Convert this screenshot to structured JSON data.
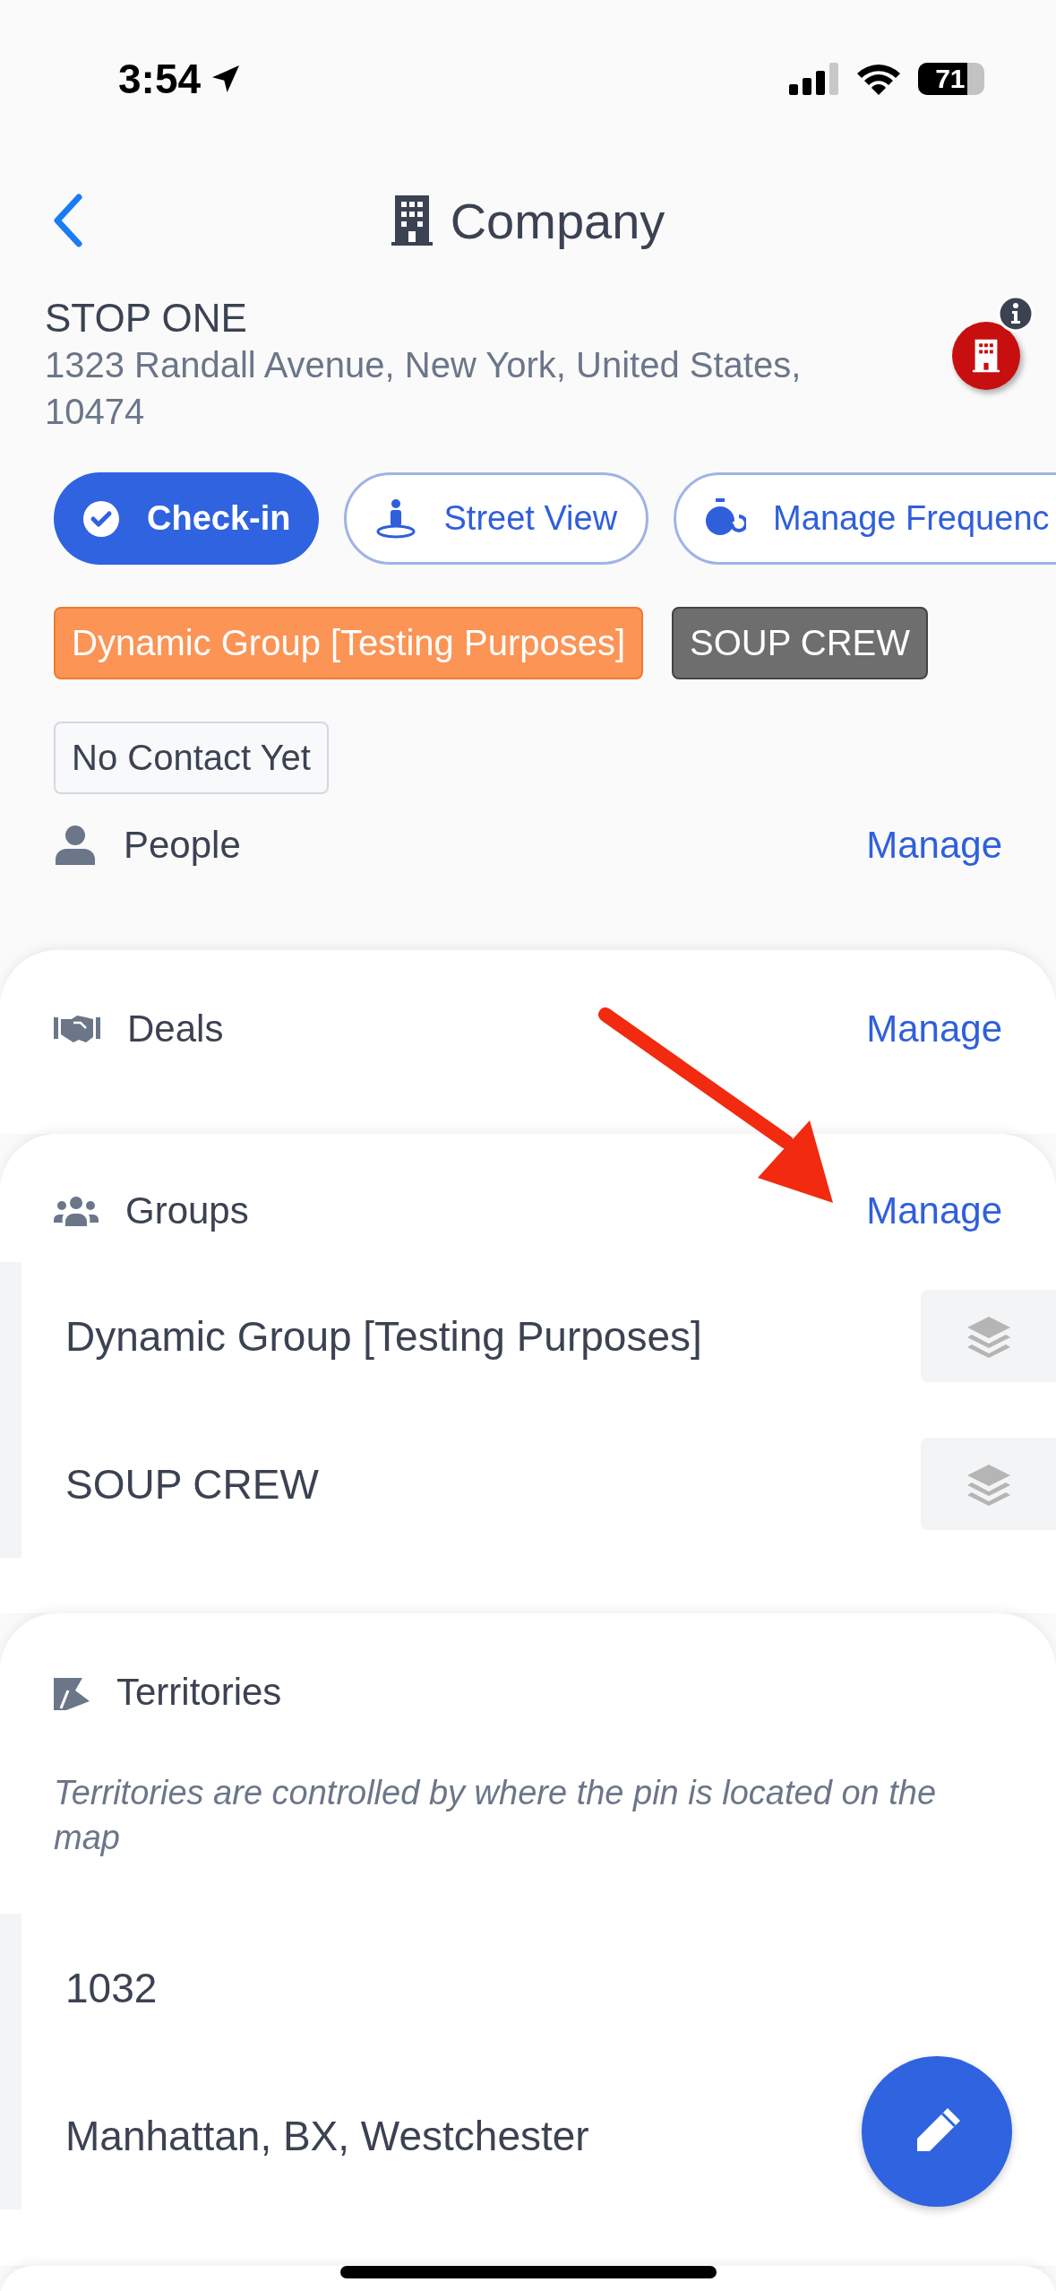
{
  "status_bar": {
    "time": "3:54",
    "battery": "71"
  },
  "nav": {
    "title": "Company"
  },
  "company": {
    "name": "STOP ONE",
    "address": "1323 Randall Avenue, New York, United States, 10474"
  },
  "actions": [
    {
      "label": "Check-in",
      "kind": "primary"
    },
    {
      "label": "Street View",
      "kind": "outline"
    },
    {
      "label": "Manage Frequenc",
      "kind": "outline"
    }
  ],
  "tags": [
    {
      "label": "Dynamic Group [Testing Purposes]",
      "color": "#fb9455"
    },
    {
      "label": "SOUP CREW",
      "color": "#6e6e6e"
    },
    {
      "label": "No Contact Yet",
      "color": "#f8f9fb"
    }
  ],
  "people": {
    "title": "People",
    "action": "Manage"
  },
  "deals": {
    "title": "Deals",
    "action": "Manage"
  },
  "groups": {
    "title": "Groups",
    "action": "Manage",
    "items": [
      "Dynamic Group [Testing Purposes]",
      "SOUP CREW"
    ]
  },
  "territories": {
    "title": "Territories",
    "note": "Territories are controlled by where the pin is located on the map",
    "items": [
      "1032",
      "Manhattan, BX, Westchester"
    ]
  }
}
